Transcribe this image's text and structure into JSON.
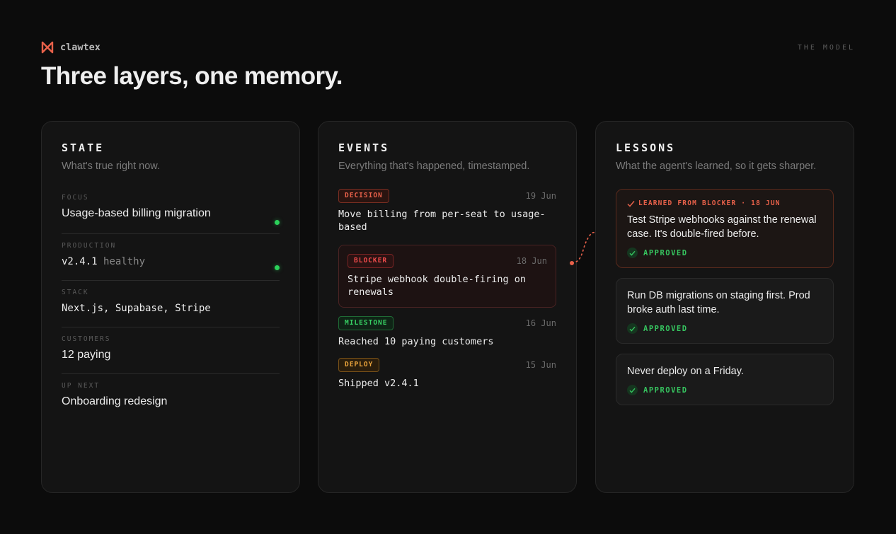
{
  "brand": {
    "name": "clawtex",
    "logo_icon": "clawtex-logo-icon"
  },
  "header": {
    "section_label": "THE MODEL",
    "title": "Three layers, one memory."
  },
  "colors": {
    "accent": "#e8614a",
    "healthy": "#2bd15a",
    "approved": "#36c45f"
  },
  "state": {
    "title": "STATE",
    "subtitle": "What's true right now.",
    "rows": [
      {
        "label": "FOCUS",
        "value": "Usage-based billing migration",
        "indicator": "green-dot"
      },
      {
        "label": "PRODUCTION",
        "value": "v2.4.1",
        "status": "healthy",
        "indicator": "green-dot"
      },
      {
        "label": "STACK",
        "value": "Next.js, Supabase, Stripe"
      },
      {
        "label": "CUSTOMERS",
        "value": "12 paying"
      },
      {
        "label": "UP NEXT",
        "value": "Onboarding redesign"
      }
    ]
  },
  "events": {
    "title": "EVENTS",
    "subtitle": "Everything that's happened, timestamped.",
    "items": [
      {
        "tag": "DECISION",
        "date": "19 Jun",
        "text": "Move billing from per-seat to usage-based"
      },
      {
        "tag": "BLOCKER",
        "date": "18 Jun",
        "text": "Stripe webhook double-firing on renewals"
      },
      {
        "tag": "MILESTONE",
        "date": "16 Jun",
        "text": "Reached 10 paying customers"
      },
      {
        "tag": "DEPLOY",
        "date": "15 Jun",
        "text": "Shipped v2.4.1"
      }
    ]
  },
  "lessons": {
    "title": "LESSONS",
    "subtitle": "What the agent's learned, so it gets sharper.",
    "items": [
      {
        "meta": "LEARNED FROM BLOCKER · 18 JUN",
        "text": "Test Stripe webhooks against the renewal case. It's double-fired before.",
        "status": "APPROVED"
      },
      {
        "text": "Run DB migrations on staging first. Prod broke auth last time.",
        "status": "APPROVED"
      },
      {
        "text": "Never deploy on a Friday.",
        "status": "APPROVED"
      }
    ]
  }
}
